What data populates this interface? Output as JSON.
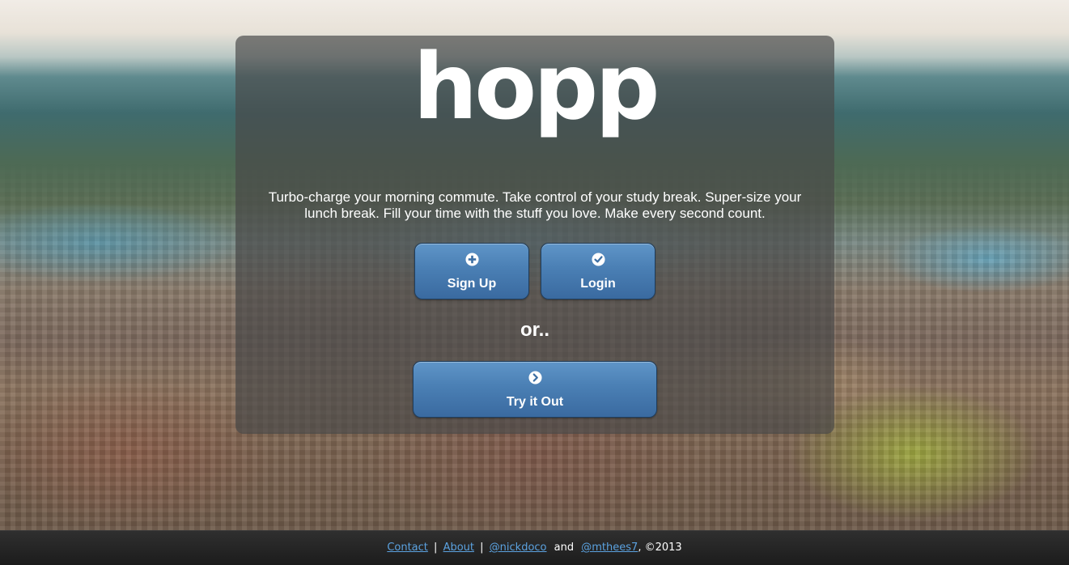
{
  "logo": {
    "text": "hopp"
  },
  "tagline": {
    "line1": "Turbo-charge your morning commute. Take control of your study break. Super-size your",
    "line2": "lunch break. Fill your time with the stuff you love. Make every second count."
  },
  "buttons": {
    "signup": {
      "label": "Sign Up",
      "icon": "plus-circle-icon"
    },
    "login": {
      "label": "Login",
      "icon": "check-circle-icon"
    },
    "try": {
      "label": "Try it Out",
      "icon": "chevron-right-circle-icon"
    }
  },
  "or_text": "or..",
  "footer": {
    "contact": "Contact",
    "separator": "|",
    "about": "About",
    "handle1": "@nickdoco",
    "and": "and",
    "handle2": "@mthees7",
    "copyright": ", ©2013"
  },
  "colors": {
    "button_top": "#5f95c8",
    "button_bottom": "#3a6aa0",
    "link": "#5ba2e0",
    "panel": "#484848",
    "footer": "#1c1c1c"
  }
}
